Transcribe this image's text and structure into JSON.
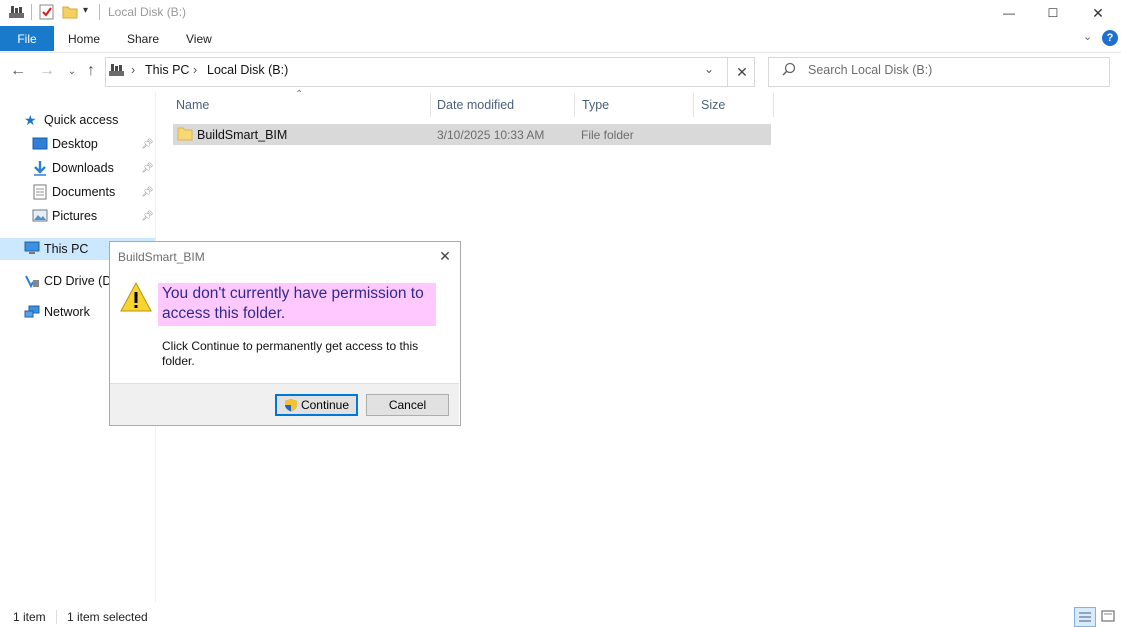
{
  "window": {
    "title": "Local Disk (B:)",
    "controls": {
      "minimize": "—",
      "maximize": "☐",
      "close": "✕"
    }
  },
  "ribbon": {
    "tabs": [
      "File",
      "Home",
      "Share",
      "View"
    ]
  },
  "address": {
    "crumbs": [
      "This PC",
      "Local Disk (B:)"
    ],
    "separator": "›"
  },
  "search": {
    "placeholder": "Search Local Disk (B:)"
  },
  "sidebar": {
    "quick_access": "Quick access",
    "items": [
      {
        "label": "Desktop",
        "icon": "desktop-icon",
        "pinned": true
      },
      {
        "label": "Downloads",
        "icon": "downloads-icon",
        "pinned": true
      },
      {
        "label": "Documents",
        "icon": "documents-icon",
        "pinned": true
      },
      {
        "label": "Pictures",
        "icon": "pictures-icon",
        "pinned": true
      }
    ],
    "this_pc": "This PC",
    "cd_drive": "CD Drive (D:",
    "network": "Network"
  },
  "columns": [
    "Name",
    "Date modified",
    "Type",
    "Size"
  ],
  "files": [
    {
      "name": "BuildSmart_BIM",
      "date": "3/10/2025 10:33 AM",
      "type": "File folder",
      "size": ""
    }
  ],
  "status": {
    "count": "1 item",
    "selected": "1 item selected"
  },
  "dialog": {
    "title": "BuildSmart_BIM",
    "main": "You don't currently have permission to access this folder.",
    "sub": "Click Continue to permanently get access to this folder.",
    "continue": "Continue",
    "cancel": "Cancel"
  },
  "colors": {
    "accent": "#1979ca",
    "selection": "#cce8ff",
    "highlight": "#ffc9ff",
    "instruction_text": "#2e2b8f"
  }
}
